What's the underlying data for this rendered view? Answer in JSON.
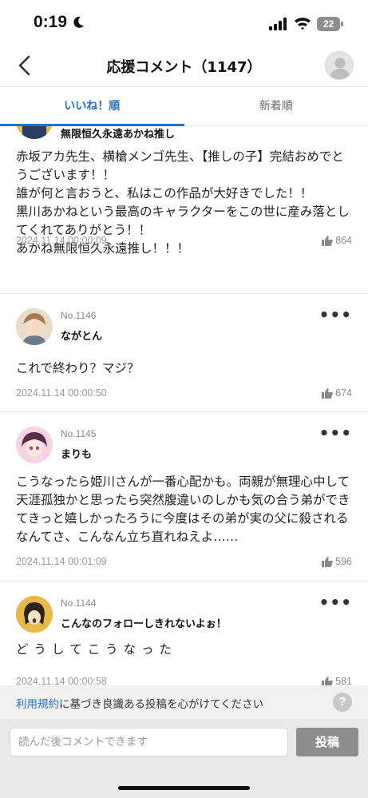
{
  "status_bar": {
    "time": "0:19",
    "battery": "22"
  },
  "header": {
    "title": "応援コメント（1147）"
  },
  "tabs": [
    {
      "label": "いいね！順",
      "active": true
    },
    {
      "label": "新着順",
      "active": false
    }
  ],
  "comments": [
    {
      "name": "無限恒久永遠あかね推し",
      "body": "赤坂アカ先生、横槍メンゴ先生、【推しの子】完結おめでとうございます！！\n誰が何と言おうと、私はこの作品が大好きでした！！\n黒川あかねという最高のキャラクターをこの世に産み落としてくれてありがとう！！\nあかね無限恒久永遠推し！！！",
      "date": "2024.11.14 00:00:09",
      "likes": "864"
    },
    {
      "number": "No.1146",
      "name": "ながとん",
      "body": "これで終わり？マジ？",
      "date": "2024.11.14 00:00:50",
      "likes": "674"
    },
    {
      "number": "No.1145",
      "name": "まりも",
      "body": "こうなったら姫川さんが一番心配かも。両親が無理心中して天涯孤独かと思ったら突然腹違いのしかも気の合う弟ができてきっと嬉しかったろうに今度はその弟が実の父に殺されるなんてさ、こんなん立ち直れねえよ……",
      "date": "2024.11.14 00:01:09",
      "likes": "596"
    },
    {
      "number": "No.1144",
      "name": "こんなのフォローしきれないよぉ！",
      "body": "ど う し て こ う な っ た",
      "date": "2024.11.14 00:00:58",
      "likes": "581"
    }
  ],
  "notice": {
    "link": "利用規約",
    "text": "に基づき良識ある投稿を心がけてください"
  },
  "composer": {
    "placeholder": "読んだ後コメントできます",
    "post_label": "投稿"
  },
  "colors": {
    "accent": "#2a6fc9",
    "post_button": "#8d8d8d"
  }
}
